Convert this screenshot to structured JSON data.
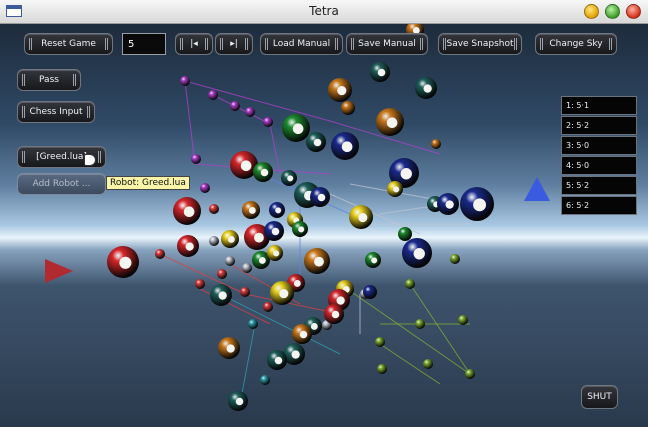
{
  "window": {
    "title": "Tetra"
  },
  "toolbar": {
    "reset_label": "Reset Game",
    "depth_value": "5",
    "step_back_label": "|◂",
    "step_forward_label": "▸|",
    "load_label": "Load Manual",
    "save_label": "Save Manual",
    "snapshot_label": "Save Snapshot",
    "sky_label": "Change Sky"
  },
  "side": {
    "pass_label": "Pass",
    "chess_label": "Chess Input",
    "robot_select": "[Greed.lua]",
    "add_robot_label": "Add Robot ...",
    "tooltip": "Robot: Greed.lua"
  },
  "scores": [
    "1: 5·1",
    "2: 5·2",
    "3: 5·0",
    "4: 5·0",
    "5: 5·2",
    "6: 5·2"
  ],
  "shut_label": "SHUT",
  "colors": {
    "red": "#d4262a",
    "green": "#1e8a2e",
    "navy": "#1a2a8c",
    "teal": "#1f5f5a",
    "orange": "#c9781c",
    "yellow": "#e8d020",
    "lattice_purple": "#b040d0",
    "lattice_red": "#e04040",
    "lattice_green": "#80b030",
    "lattice_blue": "#6080e0",
    "lattice_cyan": "#30a0b0",
    "lattice_grey": "#c0c4d0"
  }
}
